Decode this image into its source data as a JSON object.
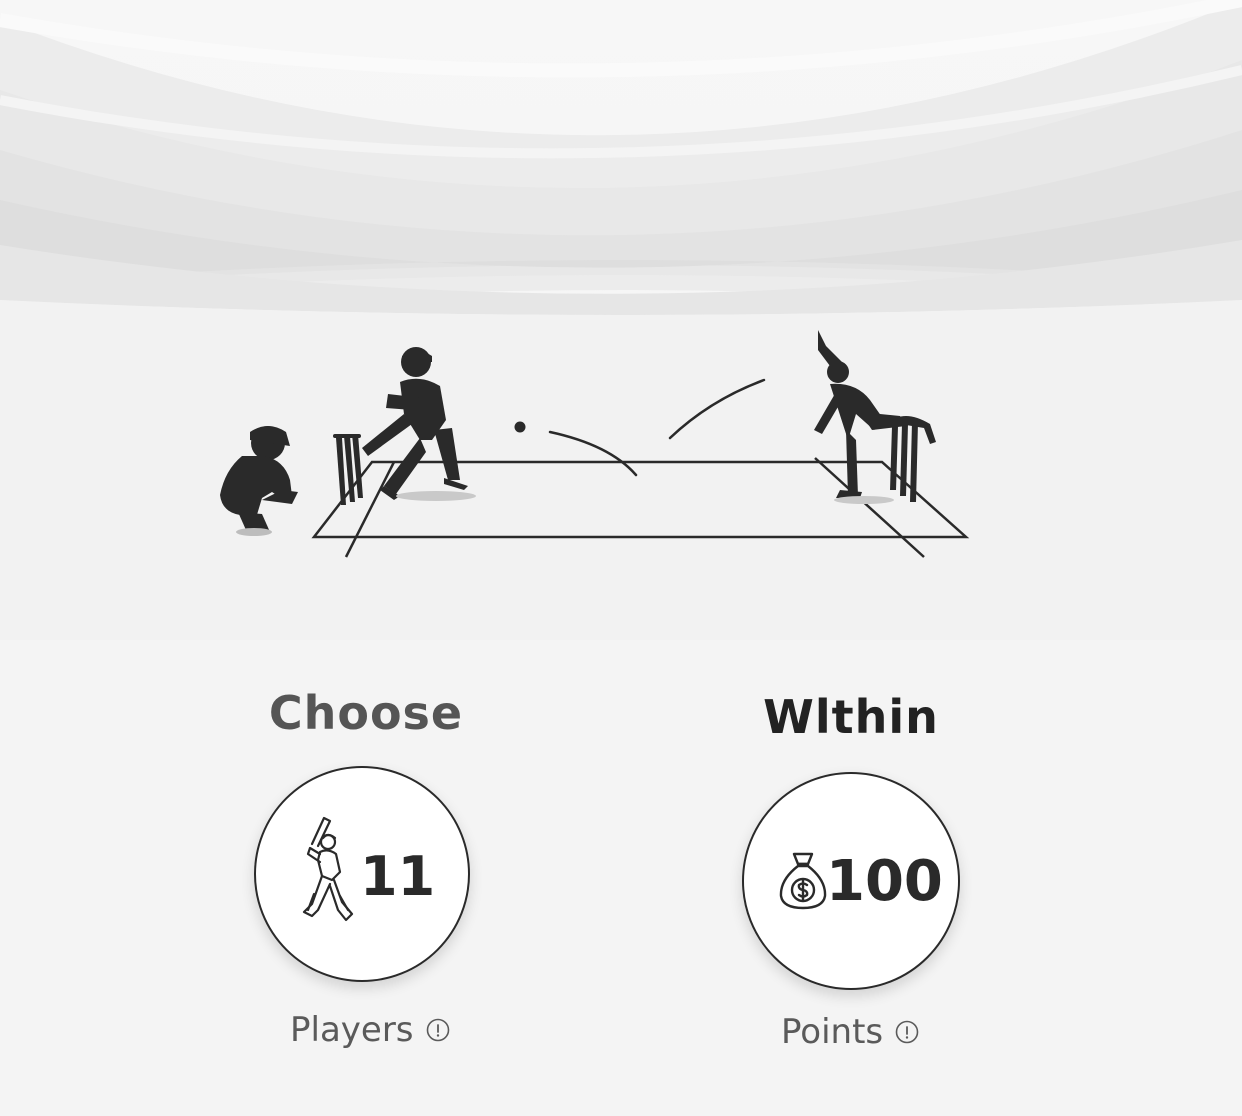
{
  "hero": {
    "scene_icons": [
      "wicket-keeper-icon",
      "batsman-icon",
      "stumps-icon",
      "ball-icon",
      "bowler-icon",
      "pitch-icon"
    ]
  },
  "players_stat": {
    "heading": "Choose",
    "value": "11",
    "caption": "Players",
    "icon": "batsman-icon",
    "info_icon": "info-icon"
  },
  "points_stat": {
    "heading": "Wlthin",
    "value": "100",
    "caption": "Points",
    "icon": "money-bag-icon",
    "info_icon": "info-icon"
  },
  "colors": {
    "background": "#f4f4f4",
    "silhouette": "#2a2a2a",
    "heading_muted": "#555555",
    "heading_dark": "#222222"
  }
}
